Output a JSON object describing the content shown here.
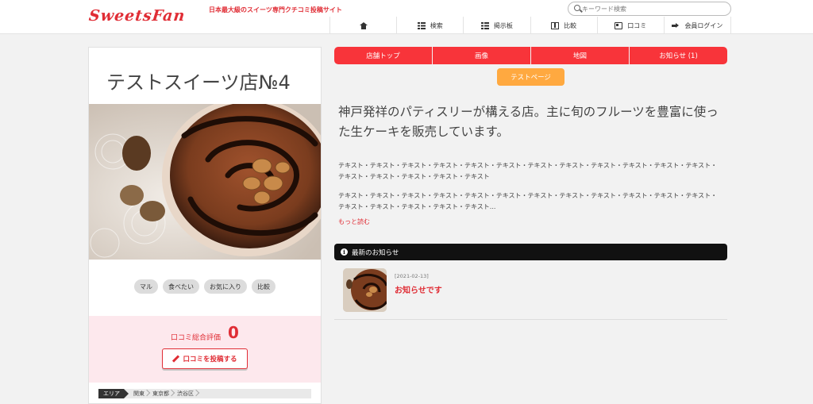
{
  "header": {
    "logo": "SweetsFan",
    "tagline": "日本最大級のスイーツ専門クチコミ投稿サイト",
    "search_placeholder": "キーワード検索",
    "nav": [
      {
        "label": "",
        "icon": "home-icon"
      },
      {
        "label": "検索",
        "icon": "list-icon"
      },
      {
        "label": "掲示板",
        "icon": "list-icon"
      },
      {
        "label": "比較",
        "icon": "columns-icon"
      },
      {
        "label": "口コミ",
        "icon": "card-icon"
      },
      {
        "label": "会員ログイン",
        "icon": "login-icon"
      }
    ]
  },
  "shop": {
    "name": "テストスイーツ店№4",
    "tags": [
      "マル",
      "食べたい",
      "お気に入り",
      "比較"
    ],
    "review_label": "口コミ総合評価",
    "review_score": "0",
    "review_button": "口コミを投稿する",
    "area_label": "エリア",
    "area_crumbs": [
      "関東",
      "東京都",
      "渋谷区"
    ]
  },
  "tabs": [
    "店舗トップ",
    "画像",
    "地図",
    "お知らせ (1)"
  ],
  "test_tab": "テストページ",
  "intro": "神戸発祥のパティスリーが構える店。主に旬のフルーツを豊富に使った生ケーキを販売しています。",
  "body_text_1": "テキスト・テキスト・テキスト・テキスト・テキスト・テキスト・テキスト・テキスト・テキスト・テキスト・テキスト・テキスト・テキスト・テキスト・テキスト・テキスト・テキスト",
  "body_text_2": "テキスト・テキスト・テキスト・テキスト・テキスト・テキスト・テキスト・テキスト・テキスト・テキスト・テキスト・テキスト・テキスト・テキスト・テキスト・テキスト・テキスト...",
  "more_link": "もっと読む",
  "news": {
    "heading": "最新のお知らせ",
    "items": [
      {
        "date": "[2021-02-13]",
        "title": "お知らせです"
      }
    ]
  },
  "colors": {
    "accent": "#e02d35",
    "tab_red": "#f8343a",
    "test_orange": "#ffa940"
  }
}
